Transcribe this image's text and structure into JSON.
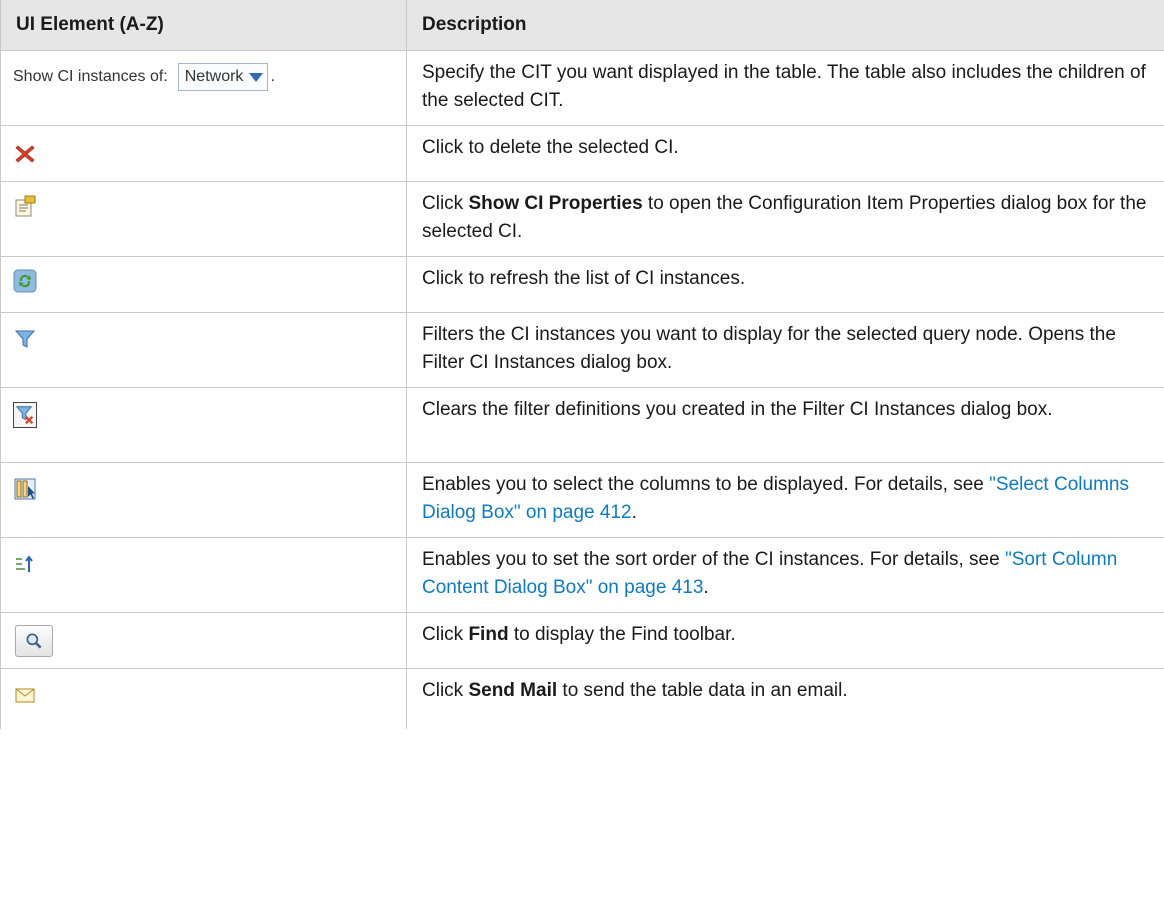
{
  "header": {
    "col1": "UI Element (A-Z)",
    "col2": "Description"
  },
  "show_ci": {
    "label": "Show CI instances of:",
    "value": "Network",
    "trailing": "."
  },
  "rows": [
    {
      "icon": "show-ci-instances-combo",
      "parts": [
        {
          "text": "Specify the CIT you want displayed in the table. The table also includes the children of the selected CIT."
        }
      ]
    },
    {
      "icon": "delete-icon",
      "parts": [
        {
          "text": "Click to delete the selected CI."
        }
      ]
    },
    {
      "icon": "properties-icon",
      "parts": [
        {
          "text": "Click "
        },
        {
          "text": "Show CI Properties",
          "bold": true
        },
        {
          "text": " to open the Configuration Item Properties dialog box for the selected CI."
        }
      ]
    },
    {
      "icon": "refresh-icon",
      "parts": [
        {
          "text": "Click to refresh the list of CI instances."
        }
      ]
    },
    {
      "icon": "filter-icon",
      "parts": [
        {
          "text": "Filters the CI instances you want to display for the selected query node. Opens the Filter CI Instances dialog box."
        }
      ]
    },
    {
      "icon": "clear-filter-icon",
      "parts": [
        {
          "text": "Clears the filter definitions you created in the Filter CI Instances dialog box."
        }
      ]
    },
    {
      "icon": "select-columns-icon",
      "parts": [
        {
          "text": "Enables you to select the columns to be displayed. For details, see "
        },
        {
          "text": "\"Select Columns Dialog Box\" on page 412",
          "link": true
        },
        {
          "text": "."
        }
      ]
    },
    {
      "icon": "sort-icon",
      "parts": [
        {
          "text": "Enables you to set the sort order of the CI instances. For details, see "
        },
        {
          "text": "\"Sort Column Content Dialog Box\" on page 413",
          "link": true
        },
        {
          "text": "."
        }
      ]
    },
    {
      "icon": "find-icon",
      "parts": [
        {
          "text": "Click "
        },
        {
          "text": "Find",
          "bold": true
        },
        {
          "text": " to display the Find toolbar."
        }
      ]
    },
    {
      "icon": "mail-icon",
      "parts": [
        {
          "text": "Click "
        },
        {
          "text": "Send Mail",
          "bold": true
        },
        {
          "text": " to send the table data in an email."
        }
      ]
    }
  ],
  "colors": {
    "header_bg": "#e6e6e6",
    "border": "#c8c8c8",
    "link": "#0e7bbf"
  }
}
